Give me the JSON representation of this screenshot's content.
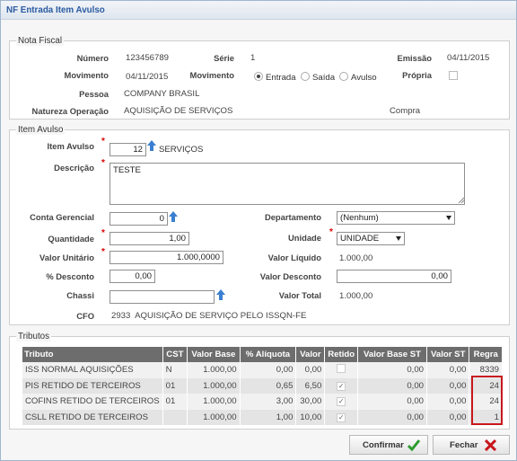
{
  "window": {
    "title": "NF Entrada Item Avulso"
  },
  "nota": {
    "legend": "Nota Fiscal",
    "numero_label": "Número",
    "numero": "123456789",
    "serie_label": "Série",
    "serie": "1",
    "emissao_label": "Emissão",
    "emissao": "04/11/2015",
    "movimento_label": "Movimento",
    "movimento": "04/11/2015",
    "movimento2_label": "Movimento",
    "radio_entrada": "Entrada",
    "radio_saida": "Saída",
    "radio_avulso": "Avulso",
    "propria_label": "Própria",
    "pessoa_label": "Pessoa",
    "pessoa": "COMPANY BRASIL",
    "natureza_label": "Natureza Operação",
    "natureza": "AQUISIÇÃO DE SERVIÇOS",
    "natureza_tipo": "Compra"
  },
  "item": {
    "legend": "Item Avulso",
    "item_label": "Item Avulso",
    "item_code": "12",
    "item_name": "SERVIÇOS",
    "descricao_label": "Descrição",
    "descricao": "TESTE",
    "conta_label": "Conta Gerencial",
    "conta": "0",
    "departamento_label": "Departamento",
    "departamento": "(Nenhum)",
    "quantidade_label": "Quantidade",
    "quantidade": "1,00",
    "unidade_label": "Unidade",
    "unidade": "UNIDADE",
    "valor_unit_label": "Valor Unitário",
    "valor_unit": "1.000,0000",
    "valor_liq_label": "Valor Líquido",
    "valor_liq": "1.000,00",
    "desconto_pct_label": "% Desconto",
    "desconto_pct": "0,00",
    "valor_desc_label": "Valor Desconto",
    "valor_desc": "0,00",
    "chassi_label": "Chassi",
    "chassi": "",
    "valor_total_label": "Valor Total",
    "valor_total": "1.000,00",
    "cfo_label": "CFO",
    "cfo": "2933  AQUISIÇÃO DE SERVIÇO PELO ISSQN-FE"
  },
  "tributos": {
    "legend": "Tributos",
    "headers": [
      "Tributo",
      "CST",
      "Valor Base",
      "% Alíquota",
      "Valor",
      "Retido",
      "Valor Base ST",
      "Valor ST",
      "Regra"
    ],
    "rows": [
      {
        "tributo": "ISS NORMAL AQUISIÇÕES",
        "cst": "N",
        "base": "1.000,00",
        "aliq": "0,00",
        "valor": "0,00",
        "retido": false,
        "base_st": "0,00",
        "valor_st": "0,00",
        "regra": "8339"
      },
      {
        "tributo": "PIS RETIDO DE TERCEIROS",
        "cst": "01",
        "base": "1.000,00",
        "aliq": "0,65",
        "valor": "6,50",
        "retido": true,
        "base_st": "0,00",
        "valor_st": "0,00",
        "regra": "24"
      },
      {
        "tributo": "COFINS RETIDO DE TERCEIROS",
        "cst": "01",
        "base": "1.000,00",
        "aliq": "3,00",
        "valor": "30,00",
        "retido": true,
        "base_st": "0,00",
        "valor_st": "0,00",
        "regra": "24"
      },
      {
        "tributo": "CSLL RETIDO DE TERCEIROS",
        "cst": "",
        "base": "1.000,00",
        "aliq": "1,00",
        "valor": "10,00",
        "retido": true,
        "base_st": "0,00",
        "valor_st": "0,00",
        "regra": "1"
      }
    ]
  },
  "buttons": {
    "confirmar": "Confirmar",
    "fechar": "Fechar"
  },
  "colors": {
    "accent": "#2a5aa0",
    "highlight": "#c8171d",
    "confirm": "#2e9b2e",
    "close": "#c8171d",
    "arrow": "#3a7fd0"
  }
}
